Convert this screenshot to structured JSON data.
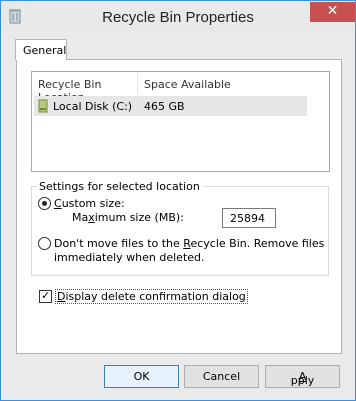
{
  "window": {
    "title": "Recycle Bin Properties",
    "close_glyph": "✕"
  },
  "tabs": [
    {
      "label": "General",
      "selected": true
    }
  ],
  "list": {
    "columns": [
      "Recycle Bin Location",
      "Space Available"
    ],
    "rows": [
      {
        "location": "Local Disk (C:)",
        "space": "465 GB",
        "icon": "drive-icon"
      }
    ]
  },
  "settings": {
    "legend": "Settings for selected location",
    "custom_size": {
      "label_pre": "C",
      "label_post": "ustom size:",
      "max_label_pre": "Ma",
      "max_label_ul": "x",
      "max_label_post": "imum size (MB):",
      "value": "25894",
      "selected": true
    },
    "dont_move": {
      "line1_pre": "Don't move files to the ",
      "line1_ul": "R",
      "line1_post": "ecycle Bin. Remove files",
      "line2": "immediately when deleted.",
      "selected": false
    }
  },
  "confirm": {
    "label_ul": "D",
    "label_post": "isplay delete confirmation dialog",
    "checked": true
  },
  "buttons": {
    "ok": "OK",
    "cancel": "Cancel",
    "apply_ul": "A",
    "apply_post": "pply"
  },
  "colors": {
    "close": "#c75050",
    "window_border": "#3f8fe0",
    "default_button_border": "#3c7fb1"
  }
}
